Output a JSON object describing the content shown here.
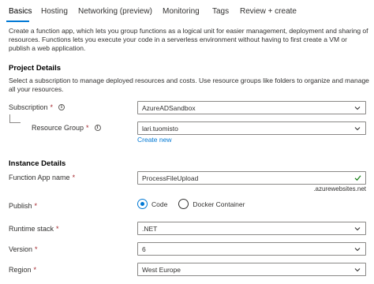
{
  "tabs": [
    {
      "label": "Basics",
      "active": true
    },
    {
      "label": "Hosting"
    },
    {
      "label": "Networking (preview)"
    },
    {
      "label": "Monitoring"
    },
    {
      "label": "Tags"
    },
    {
      "label": "Review + create"
    }
  ],
  "intro": "Create a function app, which lets you group functions as a logical unit for easier management, deployment and sharing of resources. Functions lets you execute your code in a serverless environment without having to first create a VM or publish a web application.",
  "project": {
    "title": "Project Details",
    "description": "Select a subscription to manage deployed resources and costs. Use resource groups like folders to organize and manage all your resources.",
    "subscription_label": "Subscription",
    "subscription_value": "AzureADSandbox",
    "resource_group_label": "Resource Group",
    "resource_group_value": "lari.tuomisto",
    "create_new": "Create new"
  },
  "instance": {
    "title": "Instance Details",
    "app_name_label": "Function App name",
    "app_name_value": "ProcessFileUpload",
    "app_name_suffix": ".azurewebsites.net",
    "publish_label": "Publish",
    "publish_options": [
      "Code",
      "Docker Container"
    ],
    "publish_selected": "Code",
    "runtime_label": "Runtime stack",
    "runtime_value": ".NET",
    "version_label": "Version",
    "version_value": "6",
    "region_label": "Region",
    "region_value": "West Europe"
  },
  "required_marker": "*",
  "info_glyph": "i",
  "colors": {
    "accent": "#0078d4",
    "required": "#a4262c",
    "success": "#107c10"
  }
}
